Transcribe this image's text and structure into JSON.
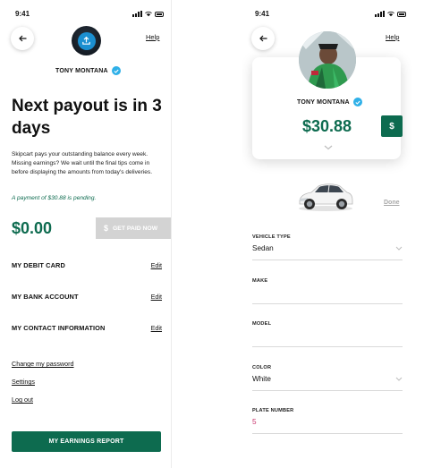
{
  "colors": {
    "brand_green": "#0d6b4f",
    "verified_blue": "#2fb0e8",
    "disabled_gray": "#d3d3d3",
    "plate_pink": "#c8326c"
  },
  "left_screen": {
    "status_time": "9:41",
    "help_label": "Help",
    "user_name": "TONY MONTANA",
    "headline": "Next payout is in 3 days",
    "description": "Skipcart pays your outstanding balance every week. Missing earnings? We wait until the final tips come in before displaying the amounts from today's deliveries.",
    "pending_note": "A payment of $30.88 is pending.",
    "balance": "$0.00",
    "get_paid_label": "GET PAID NOW",
    "get_paid_icon": "$",
    "sections": [
      {
        "title": "MY DEBIT CARD",
        "action": "Edit"
      },
      {
        "title": "MY BANK ACCOUNT",
        "action": "Edit"
      },
      {
        "title": "MY CONTACT INFORMATION",
        "action": "Edit"
      }
    ],
    "links": [
      "Change my password",
      "Settings",
      "Log out"
    ],
    "report_button": "MY EARNINGS REPORT",
    "icons": {
      "back": "arrow-left-icon",
      "avatar": "upload-icon",
      "verified": "check-badge-icon"
    }
  },
  "right_screen": {
    "status_time": "9:41",
    "help_label": "Help",
    "user_name": "TONY MONTANA",
    "balance": "$30.88",
    "pay_tab_label": "$",
    "done_label": "Done",
    "fields": [
      {
        "label": "VEHICLE TYPE",
        "value": "Sedan",
        "dropdown": true
      },
      {
        "label": "MAKE",
        "value": "",
        "dropdown": false
      },
      {
        "label": "MODEL",
        "value": "",
        "dropdown": false
      },
      {
        "label": "COLOR",
        "value": "White",
        "dropdown": true
      },
      {
        "label": "PLATE NUMBER",
        "value": "5",
        "dropdown": false
      }
    ],
    "icons": {
      "back": "arrow-left-icon",
      "vehicle": "car-image",
      "chevron": "chevron-down-icon"
    }
  }
}
